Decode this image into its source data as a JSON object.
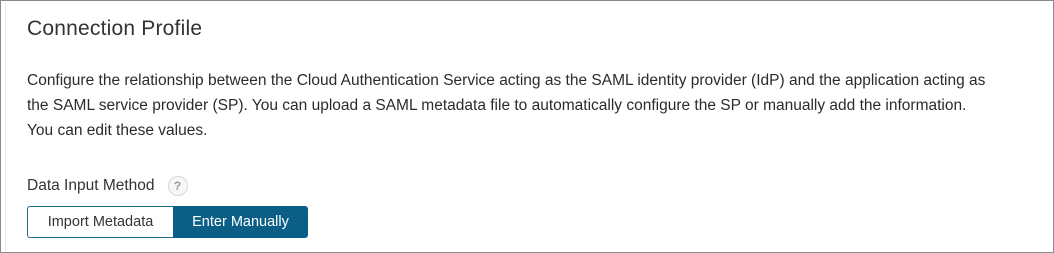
{
  "section": {
    "title": "Connection Profile",
    "description": "Configure the relationship between the Cloud Authentication Service acting as the SAML identity provider (IdP) and the application acting as the SAML service provider (SP). You can upload a SAML metadata file to automatically configure the SP or manually add the information. You can edit these values."
  },
  "data_input": {
    "label": "Data Input Method",
    "help_icon": "question-mark-icon",
    "help_glyph": "?",
    "options": [
      {
        "label": "Import Metadata",
        "selected": false
      },
      {
        "label": "Enter Manually",
        "selected": true
      }
    ]
  },
  "colors": {
    "accent": "#0b5f86",
    "text": "#333333"
  }
}
